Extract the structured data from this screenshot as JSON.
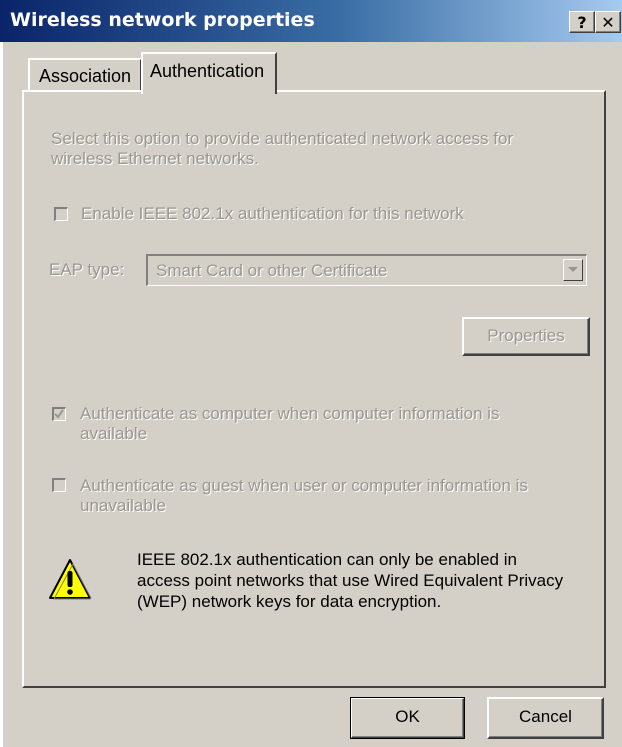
{
  "window": {
    "title": "Wireless network properties",
    "help_label": "?",
    "close_label": "✕"
  },
  "tabs": [
    {
      "label": "Association",
      "selected": false
    },
    {
      "label": "Authentication",
      "selected": true
    }
  ],
  "auth": {
    "description": "Select this option to provide authenticated network access for wireless Ethernet networks.",
    "enable_8021x": {
      "label": "Enable IEEE 802.1x authentication for this network",
      "checked": false,
      "enabled": false
    },
    "eap_type_label": "EAP type:",
    "eap_type_value": "Smart Card or other Certificate",
    "properties_label": "Properties",
    "auth_as_computer": {
      "label": "Authenticate as computer when computer information is available",
      "checked": true,
      "enabled": false
    },
    "auth_as_guest": {
      "label": "Authenticate as guest when user or computer information is unavailable",
      "checked": false,
      "enabled": false
    },
    "warning_text": "IEEE 802.1x authentication can only be enabled in access point networks that use Wired Equivalent Privacy (WEP) network keys for data encryption."
  },
  "buttons": {
    "ok_label": "OK",
    "cancel_label": "Cancel"
  },
  "icons": {
    "warning": "warning-icon",
    "dropdown": "chevron-down-icon",
    "check": "checkmark-icon"
  },
  "colors": {
    "face": "#d4d0c8",
    "title_start": "#0a246a",
    "title_end": "#a6caf0",
    "disabled_text": "#9a9690",
    "warning_yellow": "#ffff00"
  }
}
